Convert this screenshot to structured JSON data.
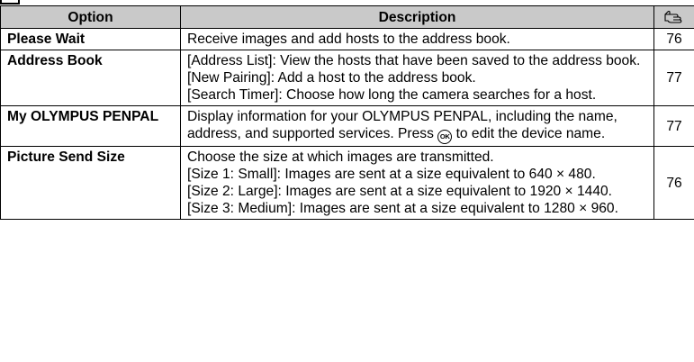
{
  "header": {
    "option": "Option",
    "description": "Description",
    "page_icon": "pointing-hand-icon"
  },
  "rows": [
    {
      "option": "Please Wait",
      "description": [
        "Receive images and add hosts to the address book."
      ],
      "page": "76"
    },
    {
      "option": "Address Book",
      "description": [
        "[Address List]: View the hosts that have been saved to the address book.",
        "[New Pairing]: Add a host to the address book.",
        "[Search Timer]: Choose how long the camera searches for a host."
      ],
      "page": "77"
    },
    {
      "option": "My OLYMPUS PENPAL",
      "description_pre": "Display information for your OLYMPUS PENPAL, including the name, address, and supported services. Press",
      "ok_label": "OK",
      "description_post": "to edit the device name.",
      "page": "77"
    },
    {
      "option": "Picture Send Size",
      "description": [
        "Choose the size at which images are transmitted.",
        "[Size 1: Small]: Images are sent at a size equivalent to 640 × 480.",
        "[Size 2: Large]: Images are sent at a size equivalent to 1920 × 1440.",
        "[Size 3: Medium]: Images are sent at a size equivalent to 1280 × 960."
      ],
      "page": "76"
    }
  ]
}
